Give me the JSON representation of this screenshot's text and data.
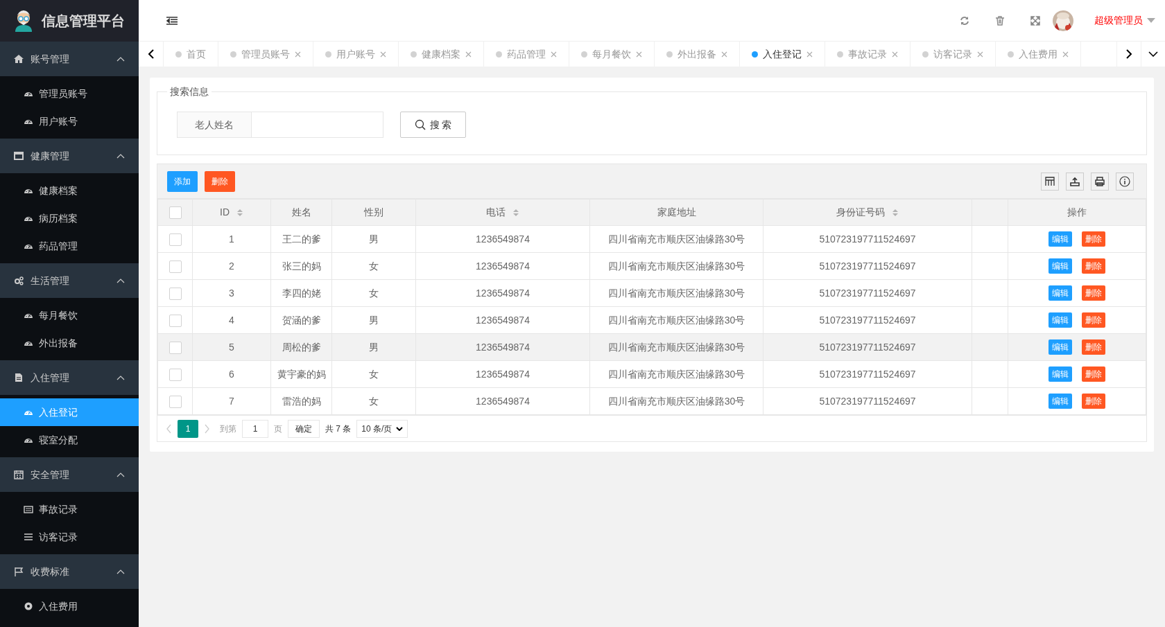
{
  "app": {
    "title": "信息管理平台"
  },
  "sidebar": {
    "groups": [
      {
        "title": "账号管理",
        "expanded": true,
        "items": [
          {
            "label": "管理员账号",
            "selected": false
          },
          {
            "label": "用户账号",
            "selected": false
          }
        ]
      },
      {
        "title": "健康管理",
        "expanded": true,
        "items": [
          {
            "label": "健康档案",
            "selected": false
          },
          {
            "label": "病历档案",
            "selected": false
          },
          {
            "label": "药品管理",
            "selected": false
          }
        ]
      },
      {
        "title": "生活管理",
        "expanded": true,
        "items": [
          {
            "label": "每月餐饮",
            "selected": false
          },
          {
            "label": "外出报备",
            "selected": false
          }
        ]
      },
      {
        "title": "入住管理",
        "expanded": true,
        "items": [
          {
            "label": "入住登记",
            "selected": true
          },
          {
            "label": "寝室分配",
            "selected": false
          }
        ]
      },
      {
        "title": "安全管理",
        "expanded": true,
        "items": [
          {
            "label": "事故记录",
            "selected": false
          },
          {
            "label": "访客记录",
            "selected": false
          }
        ]
      },
      {
        "title": "收费标准",
        "expanded": true,
        "items": [
          {
            "label": "入住费用",
            "selected": false
          }
        ]
      }
    ]
  },
  "header": {
    "user": "超级管理员"
  },
  "tabs": [
    {
      "label": "首页",
      "selected": false,
      "closable": false
    },
    {
      "label": "管理员账号",
      "selected": false,
      "closable": true
    },
    {
      "label": "用户账号",
      "selected": false,
      "closable": true
    },
    {
      "label": "健康档案",
      "selected": false,
      "closable": true
    },
    {
      "label": "药品管理",
      "selected": false,
      "closable": true
    },
    {
      "label": "每月餐饮",
      "selected": false,
      "closable": true
    },
    {
      "label": "外出报备",
      "selected": false,
      "closable": true
    },
    {
      "label": "入住登记",
      "selected": true,
      "closable": true
    },
    {
      "label": "事故记录",
      "selected": false,
      "closable": true
    },
    {
      "label": "访客记录",
      "selected": false,
      "closable": true
    },
    {
      "label": "入住费用",
      "selected": false,
      "closable": true
    }
  ],
  "search": {
    "legend": "搜索信息",
    "label": "老人姓名",
    "button": "搜 索"
  },
  "toolbar": {
    "buttons": [
      {
        "label": "添加",
        "kind": "primary"
      },
      {
        "label": "删除",
        "kind": "danger"
      }
    ]
  },
  "table": {
    "columns": [
      {
        "label": "ID",
        "sortable": true
      },
      {
        "label": "姓名",
        "sortable": false
      },
      {
        "label": "性别",
        "sortable": false
      },
      {
        "label": "电话",
        "sortable": true
      },
      {
        "label": "家庭地址",
        "sortable": false
      },
      {
        "label": "身份证号码",
        "sortable": true
      },
      {
        "label": "操作",
        "sortable": false
      }
    ],
    "all_checked": false,
    "rows": [
      {
        "cells": [
          "1",
          "王二的爹",
          "男",
          "1236549874",
          "四川省南充市顺庆区油缘路30号",
          "510723197711524697"
        ],
        "actions": [
          "编辑",
          "删除"
        ],
        "checked": false,
        "highlighted": false
      },
      {
        "cells": [
          "2",
          "张三的妈",
          "女",
          "1236549874",
          "四川省南充市顺庆区油缘路30号",
          "510723197711524697"
        ],
        "actions": [
          "编辑",
          "删除"
        ],
        "checked": false,
        "highlighted": false
      },
      {
        "cells": [
          "3",
          "李四的姥",
          "女",
          "1236549874",
          "四川省南充市顺庆区油缘路30号",
          "510723197711524697"
        ],
        "actions": [
          "编辑",
          "删除"
        ],
        "checked": false,
        "highlighted": false
      },
      {
        "cells": [
          "4",
          "贺涵的爹",
          "男",
          "1236549874",
          "四川省南充市顺庆区油缘路30号",
          "510723197711524697"
        ],
        "actions": [
          "编辑",
          "删除"
        ],
        "checked": false,
        "highlighted": false
      },
      {
        "cells": [
          "5",
          "周松的爹",
          "男",
          "1236549874",
          "四川省南充市顺庆区油缘路30号",
          "510723197711524697"
        ],
        "actions": [
          "编辑",
          "删除"
        ],
        "checked": false,
        "highlighted": true
      },
      {
        "cells": [
          "6",
          "黄宇豪的妈",
          "女",
          "1236549874",
          "四川省南充市顺庆区油缘路30号",
          "510723197711524697"
        ],
        "actions": [
          "编辑",
          "删除"
        ],
        "checked": false,
        "highlighted": false
      },
      {
        "cells": [
          "7",
          "雷浩的妈",
          "女",
          "1236549874",
          "四川省南充市顺庆区油缘路30号",
          "510723197711524697"
        ],
        "actions": [
          "编辑",
          "删除"
        ],
        "checked": false,
        "highlighted": false
      }
    ]
  },
  "pagination": {
    "pages": [
      {
        "label": "1",
        "selected": true
      }
    ],
    "goto_label": "到第",
    "goto_value": "1",
    "page_unit": "页",
    "confirm": "确定",
    "total": "共 7 条",
    "page_size": "10 条/页"
  }
}
